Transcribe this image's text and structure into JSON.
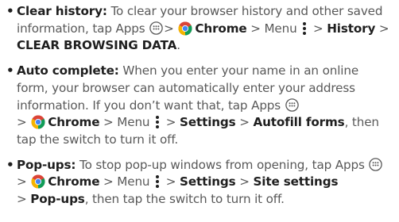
{
  "bullet_glyph": "•",
  "separator": ">",
  "items": [
    {
      "term": "Clear history:",
      "text_1": " To clear your browser history and other saved information, tap Apps ",
      "chrome": "Chrome",
      "text_2": " > Menu ",
      "path": [
        {
          "label": "History"
        },
        {
          "label": "CLEAR BROWSING DATA"
        }
      ],
      "text_end": "."
    },
    {
      "term": "Auto complete:",
      "text_1": " When you enter your name in an online form, your browser can automatically enter your address information. If you don’t want that, tap Apps ",
      "chrome": "Chrome",
      "text_2": " > Menu ",
      "path": [
        {
          "label": "Settings"
        },
        {
          "label": "Autofill forms"
        }
      ],
      "text_end": ", then tap the switch to turn it off."
    },
    {
      "term": "Pop-ups:",
      "text_1": " To stop pop-up windows from opening, tap Apps ",
      "chrome": "Chrome",
      "text_2": " > Menu ",
      "path": [
        {
          "label": "Settings"
        },
        {
          "label": "Site settings"
        },
        {
          "label": "Pop-ups"
        }
      ],
      "text_end": ", then tap the switch to turn it off."
    }
  ],
  "icons": {
    "apps": "apps-icon",
    "chrome": "chrome-icon",
    "menu": "overflow-menu-icon"
  },
  "colors": {
    "term": "#1f1f1f",
    "body": "#595959",
    "chrome_red": "#db4437",
    "chrome_yellow": "#f4b400",
    "chrome_green": "#0f9d58",
    "chrome_blue": "#4285f4"
  }
}
